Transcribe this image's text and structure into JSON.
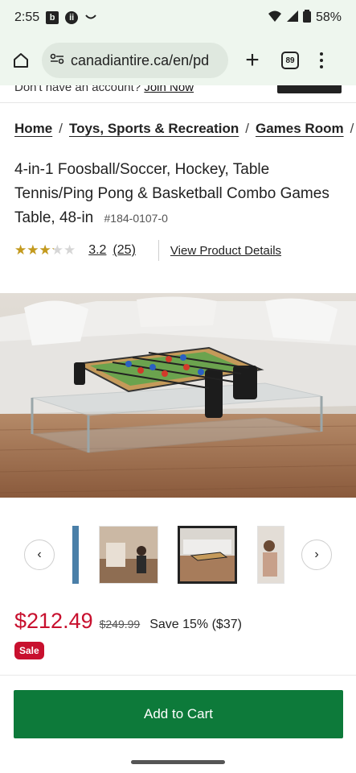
{
  "status_bar": {
    "time": "2:55",
    "icon_b": "b",
    "icon_dot": "ii",
    "battery": "58%"
  },
  "browser": {
    "url": "canadiantire.ca/en/pd",
    "tab_count": "89"
  },
  "account": {
    "prompt": "Don't have an account?",
    "join_label": "Join Now"
  },
  "breadcrumb": {
    "items": [
      "Home",
      "Toys, Sports & Recreation",
      "Games Room"
    ],
    "separator": "/"
  },
  "product": {
    "title": "4-in-1 Foosball/Soccer, Hockey, Table Tennis/Ping Pong & Basketball Combo Games Table, 48-in",
    "sku": "#184-0107-0",
    "rating": "3.2",
    "rating_fraction": 0.64,
    "stars": "★★★★★",
    "review_count": "(25)",
    "details_link": "View Product Details"
  },
  "gallery": {
    "prev_label": "‹",
    "next_label": "›",
    "thumbnail_count": 4,
    "selected_index": 2
  },
  "pricing": {
    "current": "$212.49",
    "was": "$249.99",
    "save": "Save 15% ($37)",
    "badge": "Sale"
  },
  "cart": {
    "add_label": "Add to Cart"
  },
  "colors": {
    "brand_red": "#c8102e",
    "cart_green": "#0d7a3a",
    "star_gold": "#c49a1c"
  }
}
